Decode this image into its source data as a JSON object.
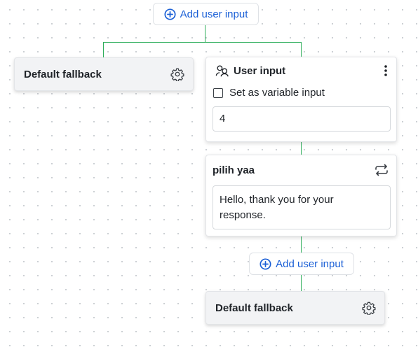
{
  "top_add_button": {
    "label": "Add user input",
    "icon": "plus-circle-icon"
  },
  "left_fallback": {
    "label": "Default fallback",
    "icon": "gear-icon"
  },
  "user_input_card": {
    "title": "User input",
    "icon": "users-icon",
    "menu_icon": "more-vertical-icon",
    "checkbox_label": "Set as variable input",
    "checkbox_checked": false,
    "input_value": "4"
  },
  "response_card": {
    "title": "pilih yaa",
    "icon": "repeat-icon",
    "message": "Hello, thank you for your response."
  },
  "bottom_add_button": {
    "label": "Add user input",
    "icon": "plus-circle-icon"
  },
  "bottom_fallback": {
    "label": "Default fallback",
    "icon": "gear-icon"
  },
  "colors": {
    "connector": "#2fae5c",
    "link": "#1a5fd6",
    "canvas_dot": "#c9cdd2"
  }
}
